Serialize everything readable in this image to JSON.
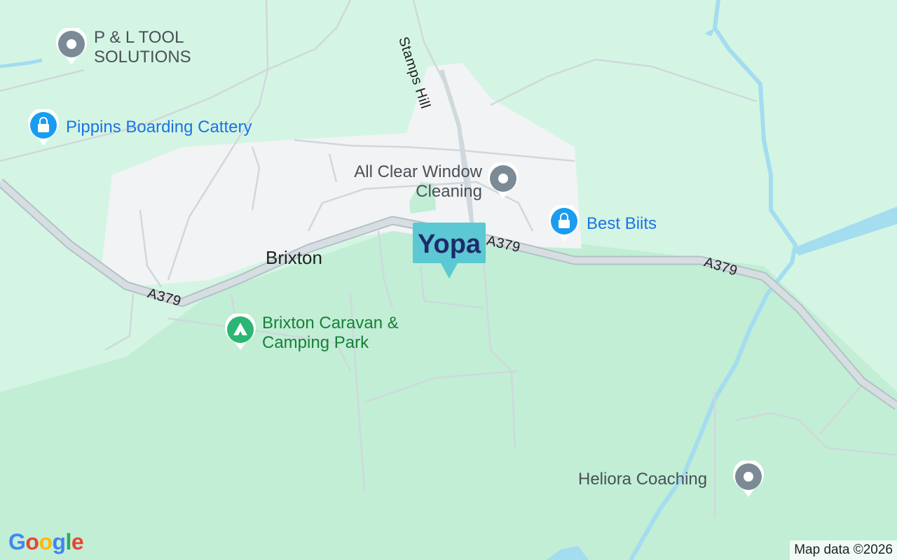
{
  "map": {
    "colors": {
      "land": "#d4f5e3",
      "woodland": "#c1eed5",
      "urban": "#f1f3f4",
      "road": "#cfd8dc",
      "water": "#a4dcf0",
      "pin_grey": "#7c8a96",
      "pin_blue": "#1a9cf0",
      "pin_green": "#2bb673",
      "brand": "#5bc8d4"
    },
    "town_label": "Brixton",
    "road_labels": [
      "A379",
      "A379",
      "A379"
    ],
    "street_label": "Stamps Hill",
    "brand_marker": {
      "text": "Yopa",
      "icon": "brand-marker"
    },
    "places": [
      {
        "name": "P & L TOOL SOLUTIONS",
        "icon": "circle-pin-icon",
        "category": "generic"
      },
      {
        "name": "Pippins Boarding Cattery",
        "icon": "shopping-bag-pin-icon",
        "category": "shop"
      },
      {
        "name": "All Clear Window Cleaning",
        "icon": "circle-pin-icon",
        "category": "generic"
      },
      {
        "name": "Best Biits",
        "icon": "shopping-bag-pin-icon",
        "category": "shop"
      },
      {
        "name": "Brixton Caravan & Camping Park",
        "icon": "tent-pin-icon",
        "category": "campsite"
      },
      {
        "name": "Heliora Coaching",
        "icon": "circle-pin-icon",
        "category": "generic"
      }
    ],
    "attribution": "Map data ©2026",
    "logo": "Google"
  }
}
